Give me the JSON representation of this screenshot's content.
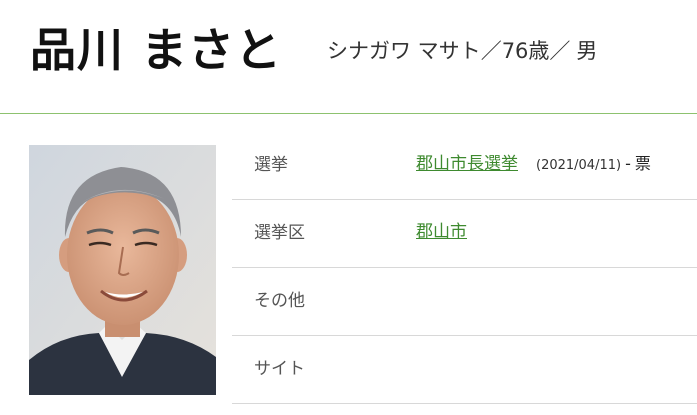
{
  "profile": {
    "name": "品川 まさと",
    "kana": "シナガワ マサト",
    "separator": "／",
    "age": "76歳",
    "gender": "男"
  },
  "photo": {
    "alt": "品川 まさと"
  },
  "rows": [
    {
      "label": "選挙",
      "value": "郡山市長選挙",
      "date": "(2021/04/11)",
      "dash": "-",
      "votes": "票"
    },
    {
      "label": "選挙区",
      "value": "郡山市"
    },
    {
      "label": "その他",
      "value": ""
    },
    {
      "label": "サイト",
      "value": ""
    }
  ],
  "colors": {
    "link": "#3e8a2f",
    "header_rule": "#8dc26f",
    "row_rule": "#d8d8d8"
  }
}
